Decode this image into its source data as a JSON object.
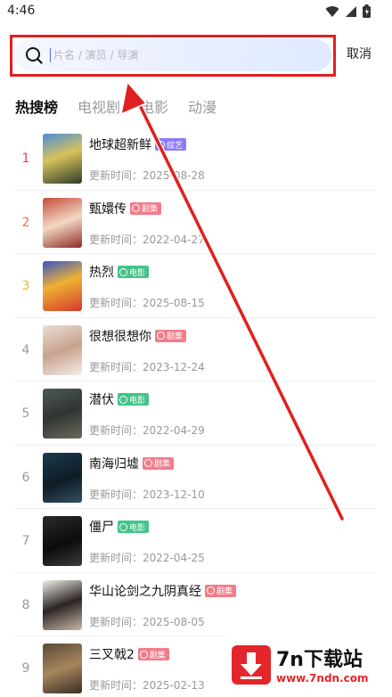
{
  "status_bar": {
    "time": "4:46"
  },
  "search": {
    "placeholder": "片名 / 演员 / 导演",
    "value": "",
    "cancel_label": "取消"
  },
  "tabs": [
    {
      "label": "热搜榜",
      "active": true
    },
    {
      "label": "电视剧",
      "active": false
    },
    {
      "label": "电影",
      "active": false
    },
    {
      "label": "动漫",
      "active": false
    }
  ],
  "list": [
    {
      "rank": "1",
      "title": "地球超新鲜",
      "badge": "综艺",
      "updated": "更新时间：2025-08-28"
    },
    {
      "rank": "2",
      "title": "甄嬛传",
      "badge": "剧集",
      "updated": "更新时间：2022-04-27"
    },
    {
      "rank": "3",
      "title": "热烈",
      "badge": "电影",
      "updated": "更新时间：2025-08-15"
    },
    {
      "rank": "4",
      "title": "很想很想你",
      "badge": "剧集",
      "updated": "更新时间：2023-12-24"
    },
    {
      "rank": "5",
      "title": "潜伏",
      "badge": "电影",
      "updated": "更新时间：2022-04-29"
    },
    {
      "rank": "6",
      "title": "南海归墟",
      "badge": "剧集",
      "updated": "更新时间：2023-12-10"
    },
    {
      "rank": "7",
      "title": "僵尸",
      "badge": "电影",
      "updated": "更新时间：2022-04-25"
    },
    {
      "rank": "8",
      "title": "华山论剑之九阴真经",
      "badge": "剧集",
      "updated": "更新时间：2025-08-05"
    },
    {
      "rank": "9",
      "title": "三叉戟2",
      "badge": "剧集",
      "updated": "更新时间：2025-02-13"
    }
  ],
  "colors": {
    "rank_1": "#e8336d",
    "rank_2": "#f0714a",
    "rank_3": "#f2b233",
    "rank_other": "#999999",
    "badge_variety": "#8b7cf6",
    "badge_series": "#f27c8a",
    "badge_movie": "#43c489",
    "highlight": "#e02020"
  },
  "watermark": {
    "title": "7n下载站",
    "url": "www.7ndn.com"
  }
}
